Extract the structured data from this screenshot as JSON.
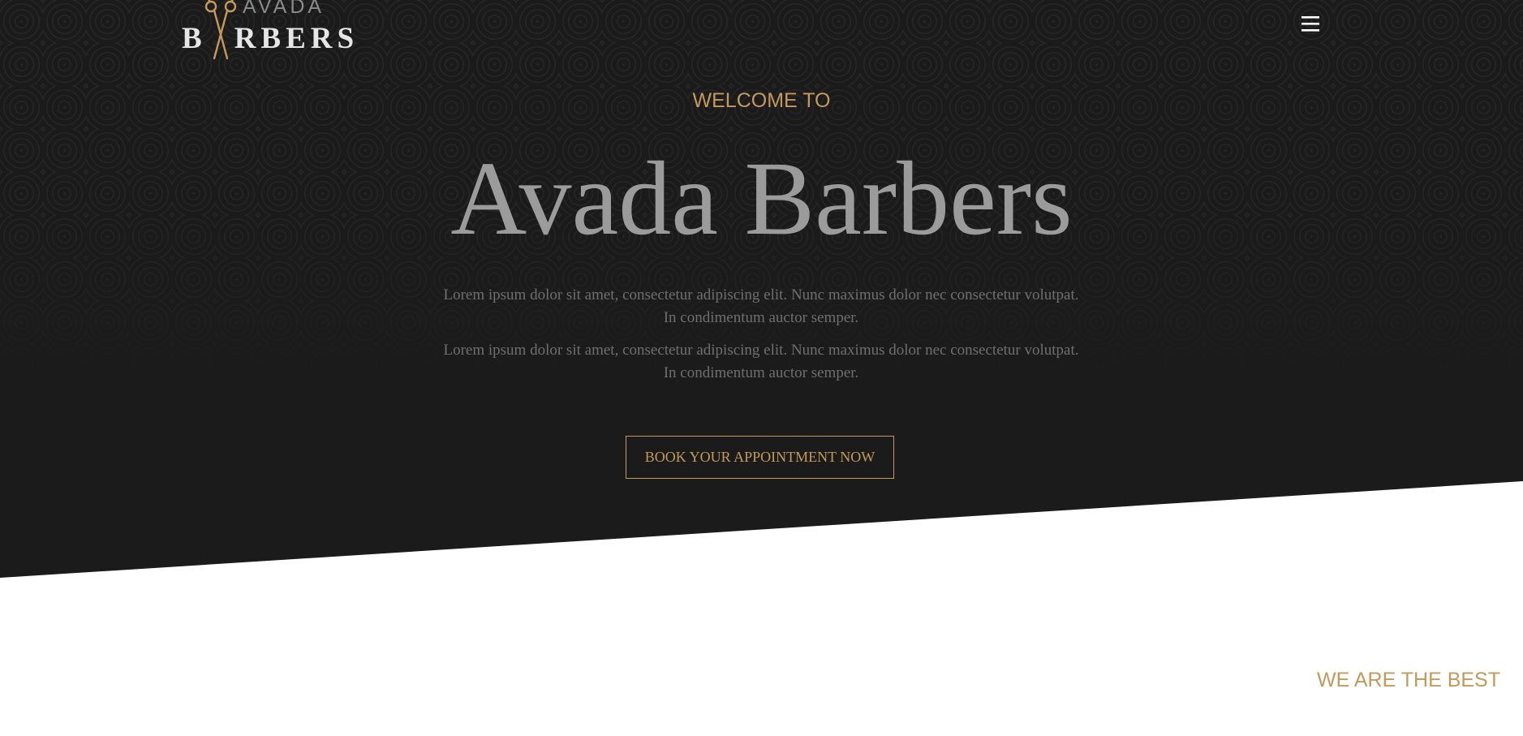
{
  "header": {
    "logo_top": "AVADA",
    "logo_main_first": "B",
    "logo_main_rest": "RBERS",
    "menu_icon": "hamburger-menu-icon"
  },
  "hero": {
    "kicker": "WELCOME TO",
    "title": "Avada Barbers",
    "paragraph_1_line_1": "Lorem ipsum dolor sit amet, consectetur adipiscing elit. Nunc maximus dolor nec consectetur volutpat.",
    "paragraph_1_line_2": "In condimentum auctor semper.",
    "paragraph_2_line_1": "Lorem ipsum dolor sit amet, consectetur adipiscing elit. Nunc maximus dolor nec consectetur volutpat.",
    "paragraph_2_line_2": "In condimentum auctor semper.",
    "cta_label": "BOOK YOUR APPOINTMENT NOW"
  },
  "next_section": {
    "label": "WE ARE THE BEST"
  },
  "colors": {
    "accent": "#c39a59",
    "hero_background": "#1b1b1b",
    "title": "#9b9b9b",
    "body_text": "#6f6f6f"
  }
}
